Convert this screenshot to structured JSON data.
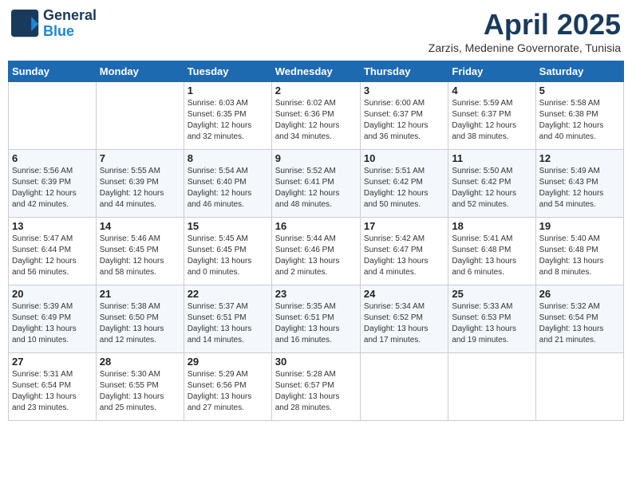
{
  "header": {
    "logo_line1": "General",
    "logo_line2": "Blue",
    "month": "April 2025",
    "location": "Zarzis, Medenine Governorate, Tunisia"
  },
  "weekdays": [
    "Sunday",
    "Monday",
    "Tuesday",
    "Wednesday",
    "Thursday",
    "Friday",
    "Saturday"
  ],
  "weeks": [
    [
      {
        "day": "",
        "text": ""
      },
      {
        "day": "",
        "text": ""
      },
      {
        "day": "1",
        "text": "Sunrise: 6:03 AM\nSunset: 6:35 PM\nDaylight: 12 hours\nand 32 minutes."
      },
      {
        "day": "2",
        "text": "Sunrise: 6:02 AM\nSunset: 6:36 PM\nDaylight: 12 hours\nand 34 minutes."
      },
      {
        "day": "3",
        "text": "Sunrise: 6:00 AM\nSunset: 6:37 PM\nDaylight: 12 hours\nand 36 minutes."
      },
      {
        "day": "4",
        "text": "Sunrise: 5:59 AM\nSunset: 6:37 PM\nDaylight: 12 hours\nand 38 minutes."
      },
      {
        "day": "5",
        "text": "Sunrise: 5:58 AM\nSunset: 6:38 PM\nDaylight: 12 hours\nand 40 minutes."
      }
    ],
    [
      {
        "day": "6",
        "text": "Sunrise: 5:56 AM\nSunset: 6:39 PM\nDaylight: 12 hours\nand 42 minutes."
      },
      {
        "day": "7",
        "text": "Sunrise: 5:55 AM\nSunset: 6:39 PM\nDaylight: 12 hours\nand 44 minutes."
      },
      {
        "day": "8",
        "text": "Sunrise: 5:54 AM\nSunset: 6:40 PM\nDaylight: 12 hours\nand 46 minutes."
      },
      {
        "day": "9",
        "text": "Sunrise: 5:52 AM\nSunset: 6:41 PM\nDaylight: 12 hours\nand 48 minutes."
      },
      {
        "day": "10",
        "text": "Sunrise: 5:51 AM\nSunset: 6:42 PM\nDaylight: 12 hours\nand 50 minutes."
      },
      {
        "day": "11",
        "text": "Sunrise: 5:50 AM\nSunset: 6:42 PM\nDaylight: 12 hours\nand 52 minutes."
      },
      {
        "day": "12",
        "text": "Sunrise: 5:49 AM\nSunset: 6:43 PM\nDaylight: 12 hours\nand 54 minutes."
      }
    ],
    [
      {
        "day": "13",
        "text": "Sunrise: 5:47 AM\nSunset: 6:44 PM\nDaylight: 12 hours\nand 56 minutes."
      },
      {
        "day": "14",
        "text": "Sunrise: 5:46 AM\nSunset: 6:45 PM\nDaylight: 12 hours\nand 58 minutes."
      },
      {
        "day": "15",
        "text": "Sunrise: 5:45 AM\nSunset: 6:45 PM\nDaylight: 13 hours\nand 0 minutes."
      },
      {
        "day": "16",
        "text": "Sunrise: 5:44 AM\nSunset: 6:46 PM\nDaylight: 13 hours\nand 2 minutes."
      },
      {
        "day": "17",
        "text": "Sunrise: 5:42 AM\nSunset: 6:47 PM\nDaylight: 13 hours\nand 4 minutes."
      },
      {
        "day": "18",
        "text": "Sunrise: 5:41 AM\nSunset: 6:48 PM\nDaylight: 13 hours\nand 6 minutes."
      },
      {
        "day": "19",
        "text": "Sunrise: 5:40 AM\nSunset: 6:48 PM\nDaylight: 13 hours\nand 8 minutes."
      }
    ],
    [
      {
        "day": "20",
        "text": "Sunrise: 5:39 AM\nSunset: 6:49 PM\nDaylight: 13 hours\nand 10 minutes."
      },
      {
        "day": "21",
        "text": "Sunrise: 5:38 AM\nSunset: 6:50 PM\nDaylight: 13 hours\nand 12 minutes."
      },
      {
        "day": "22",
        "text": "Sunrise: 5:37 AM\nSunset: 6:51 PM\nDaylight: 13 hours\nand 14 minutes."
      },
      {
        "day": "23",
        "text": "Sunrise: 5:35 AM\nSunset: 6:51 PM\nDaylight: 13 hours\nand 16 minutes."
      },
      {
        "day": "24",
        "text": "Sunrise: 5:34 AM\nSunset: 6:52 PM\nDaylight: 13 hours\nand 17 minutes."
      },
      {
        "day": "25",
        "text": "Sunrise: 5:33 AM\nSunset: 6:53 PM\nDaylight: 13 hours\nand 19 minutes."
      },
      {
        "day": "26",
        "text": "Sunrise: 5:32 AM\nSunset: 6:54 PM\nDaylight: 13 hours\nand 21 minutes."
      }
    ],
    [
      {
        "day": "27",
        "text": "Sunrise: 5:31 AM\nSunset: 6:54 PM\nDaylight: 13 hours\nand 23 minutes."
      },
      {
        "day": "28",
        "text": "Sunrise: 5:30 AM\nSunset: 6:55 PM\nDaylight: 13 hours\nand 25 minutes."
      },
      {
        "day": "29",
        "text": "Sunrise: 5:29 AM\nSunset: 6:56 PM\nDaylight: 13 hours\nand 27 minutes."
      },
      {
        "day": "30",
        "text": "Sunrise: 5:28 AM\nSunset: 6:57 PM\nDaylight: 13 hours\nand 28 minutes."
      },
      {
        "day": "",
        "text": ""
      },
      {
        "day": "",
        "text": ""
      },
      {
        "day": "",
        "text": ""
      }
    ]
  ]
}
